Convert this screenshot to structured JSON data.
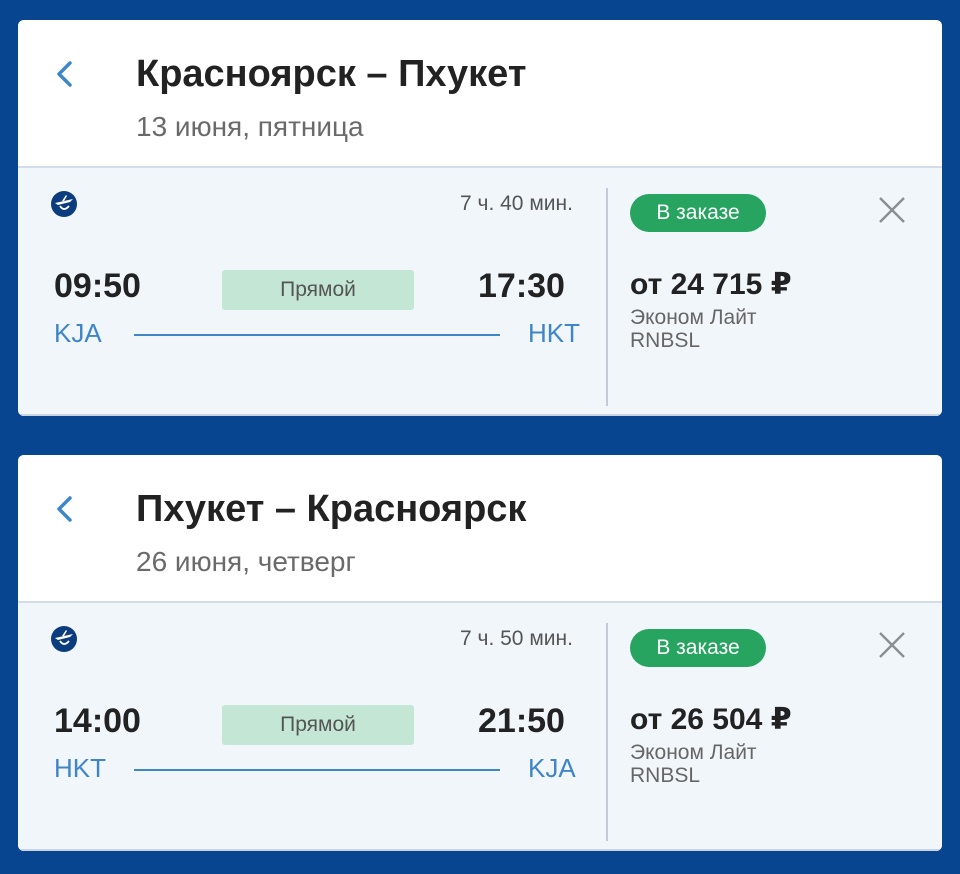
{
  "colors": {
    "page_background": "#084590",
    "accent_blue": "#3f86c8",
    "status_green": "#26a460",
    "direct_badge_bg": "#c4e7d5",
    "flight_panel_bg": "#f1f6fb"
  },
  "icons": {
    "back": "chevron-left-icon",
    "close": "close-icon",
    "airline": "airline-logo-icon"
  },
  "segments": [
    {
      "title": "Красноярск – Пхукет",
      "date": "13 июня, пятница",
      "flight": {
        "duration": "7 ч. 40 мин.",
        "departure_time": "09:50",
        "departure_code": "KJA",
        "arrival_time": "17:30",
        "arrival_code": "HKT",
        "direct_label": "Прямой",
        "status": "В заказе",
        "price": "от 24 715 ₽",
        "fare_name": "Эконом Лайт",
        "fare_code": "RNBSL"
      }
    },
    {
      "title": "Пхукет – Красноярск",
      "date": "26 июня, четверг",
      "flight": {
        "duration": "7 ч. 50 мин.",
        "departure_time": "14:00",
        "departure_code": "HKT",
        "arrival_time": "21:50",
        "arrival_code": "KJA",
        "direct_label": "Прямой",
        "status": "В заказе",
        "price": "от 26 504 ₽",
        "fare_name": "Эконом Лайт",
        "fare_code": "RNBSL"
      }
    }
  ]
}
